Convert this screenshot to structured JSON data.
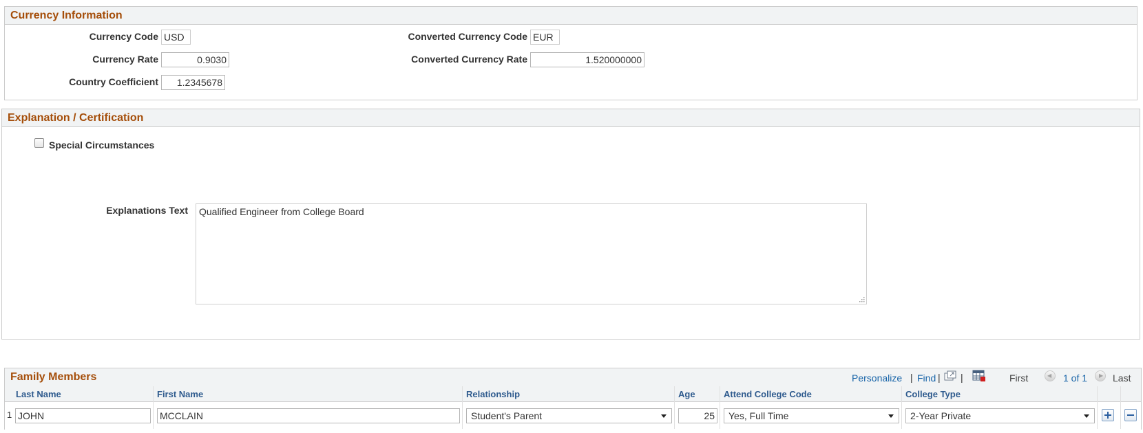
{
  "currency": {
    "title": "Currency Information",
    "currency_code_label": "Currency Code",
    "currency_code": "USD",
    "currency_rate_label": "Currency Rate",
    "currency_rate": "0.9030",
    "country_coefficient_label": "Country Coefficient",
    "country_coefficient": "1.2345678",
    "converted_code_label": "Converted Currency Code",
    "converted_code": "EUR",
    "converted_rate_label": "Converted Currency Rate",
    "converted_rate": "1.520000000"
  },
  "explanation": {
    "title": "Explanation / Certification",
    "special_label": "Special Circumstances",
    "special_checked": false,
    "text_label": "Explanations Text",
    "text_value": "Qualified Engineer from College Board"
  },
  "family": {
    "title": "Family Members",
    "toolbar": {
      "personalize": "Personalize",
      "find": "Find",
      "sep": "|",
      "first": "First",
      "count": "1 of 1",
      "last": "Last"
    },
    "columns": {
      "last_name": "Last Name",
      "first_name": "First Name",
      "relationship": "Relationship",
      "age": "Age",
      "attend": "Attend College Code",
      "college_type": "College Type"
    },
    "rows": [
      {
        "num": "1",
        "last_name": "JOHN",
        "first_name": "MCCLAIN",
        "relationship": "Student's Parent",
        "age": "25",
        "attend": "Yes, Full Time",
        "college_type": "2-Year Private"
      }
    ]
  },
  "colors": {
    "section_title": "#a54e0a",
    "link": "#1864a8",
    "column_header": "#2f5b8e"
  }
}
